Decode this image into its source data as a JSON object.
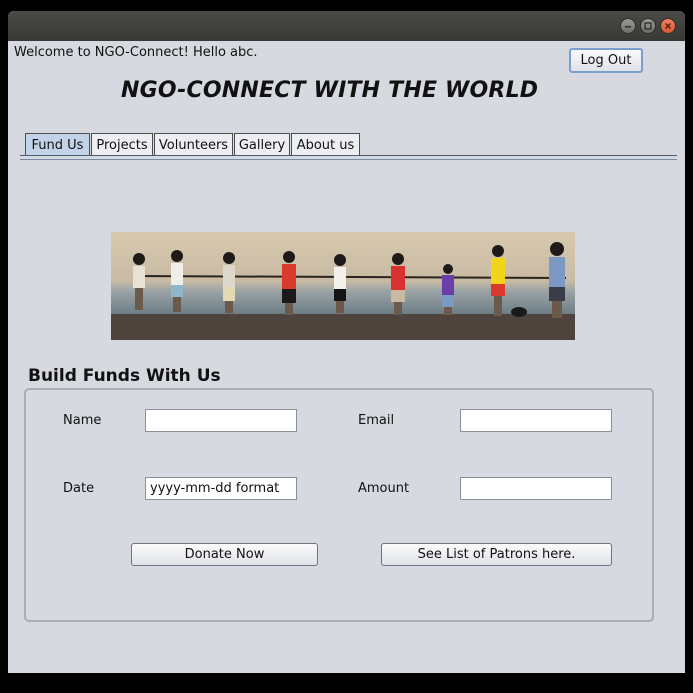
{
  "window": {
    "controls": [
      "minimize-icon",
      "maximize-icon",
      "close-icon"
    ]
  },
  "header": {
    "welcome": "Welcome to NGO-Connect! Hello abc.",
    "logout_label": "Log Out",
    "title": "NGO-CONNECT WITH THE WORLD"
  },
  "tabs": [
    {
      "label": "Fund Us",
      "active": true
    },
    {
      "label": "Projects",
      "active": false
    },
    {
      "label": "Volunteers",
      "active": false
    },
    {
      "label": "Gallery",
      "active": false
    },
    {
      "label": "About us",
      "active": false
    }
  ],
  "form": {
    "section_title": "Build Funds With Us",
    "name_label": "Name",
    "name_value": "",
    "email_label": "Email",
    "email_value": "",
    "date_label": "Date",
    "date_value": "yyyy-mm-dd format",
    "amount_label": "Amount",
    "amount_value": "",
    "donate_label": "Donate Now",
    "patrons_label": "See List of Patrons here."
  },
  "colors": {
    "window_bg": "#d6d9e0",
    "active_tab": "#c2d3e8",
    "titlebar": "#3c3c38",
    "close_button": "#e0653c"
  }
}
